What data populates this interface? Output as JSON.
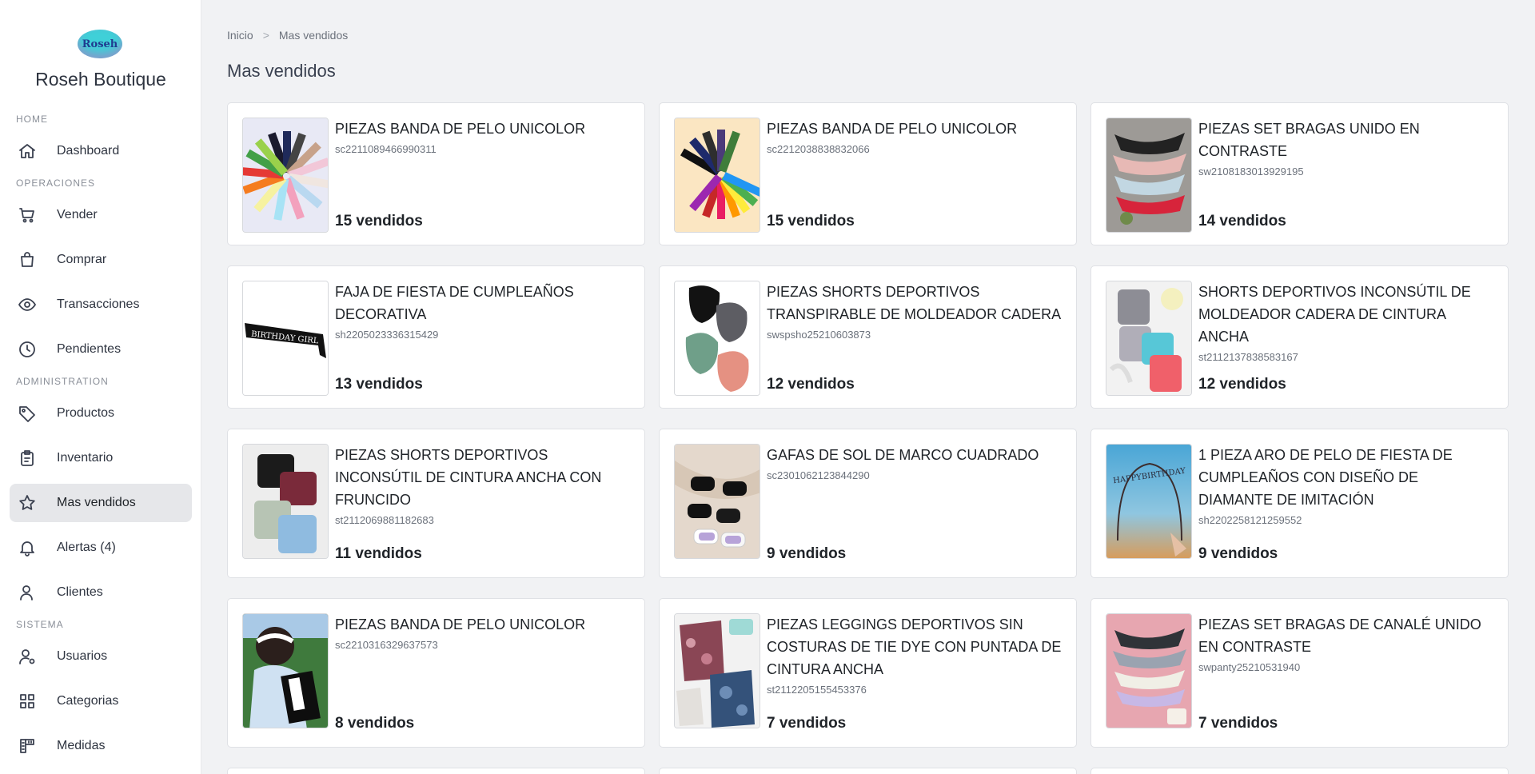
{
  "app": {
    "brand": "Roseh Boutique",
    "logo_text": "Roseh"
  },
  "sidebar": {
    "sections": [
      {
        "label": "HOME",
        "items": [
          {
            "label": "Dashboard",
            "icon": "home-icon"
          }
        ]
      },
      {
        "label": "OPERACIONES",
        "items": [
          {
            "label": "Vender",
            "icon": "cart-icon"
          },
          {
            "label": "Comprar",
            "icon": "shopping-bag-icon"
          },
          {
            "label": "Transacciones",
            "icon": "eye-icon"
          },
          {
            "label": "Pendientes",
            "icon": "clock-icon"
          }
        ]
      },
      {
        "label": "ADMINISTRATION",
        "items": [
          {
            "label": "Productos",
            "icon": "tag-icon"
          },
          {
            "label": "Inventario",
            "icon": "clipboard-icon"
          },
          {
            "label": "Mas vendidos",
            "icon": "star-icon",
            "active": true
          },
          {
            "label": "Alertas (4)",
            "icon": "bell-icon"
          },
          {
            "label": "Clientes",
            "icon": "user-icon"
          }
        ]
      },
      {
        "label": "SISTEMA",
        "items": [
          {
            "label": "Usuarios",
            "icon": "user-gear-icon"
          },
          {
            "label": "Categorias",
            "icon": "grid-icon"
          },
          {
            "label": "Medidas",
            "icon": "ruler-icon"
          }
        ]
      }
    ]
  },
  "breadcrumb": {
    "home": "Inicio",
    "current": "Mas vendidos"
  },
  "page": {
    "title": "Mas vendidos"
  },
  "products": [
    {
      "name": "PIEZAS BANDA DE PELO UNICOLOR",
      "sku": "sc2211089466990311",
      "sold": "15 vendidos",
      "thumb": "headbands-fan"
    },
    {
      "name": "PIEZAS BANDA DE PELO UNICOLOR",
      "sku": "sc2212038838832066",
      "sold": "15 vendidos",
      "thumb": "headbands-fan-cream"
    },
    {
      "name": "PIEZAS SET BRAGAS UNIDO EN CONTRASTE",
      "sku": "sw2108183013929195",
      "sold": "14 vendidos",
      "thumb": "panties"
    },
    {
      "name": "FAJA DE FIESTA DE CUMPLEAÑOS DECORATIVA",
      "sku": "sh2205023336315429",
      "sold": "13 vendidos",
      "thumb": "birthday-sash",
      "thumb_text": "BIRTHDAY GIRL"
    },
    {
      "name": "PIEZAS SHORTS DEPORTIVOS TRANSPIRABLE DE MOLDEADOR CADERA",
      "sku": "swspsho25210603873",
      "sold": "12 vendidos",
      "thumb": "shorts"
    },
    {
      "name": "SHORTS DEPORTIVOS INCONSÚTIL DE MOLDEADOR CADERA DE CINTURA ANCHA",
      "sku": "st2112137838583167",
      "sold": "12 vendidos",
      "thumb": "shorts-color"
    },
    {
      "name": "PIEZAS SHORTS DEPORTIVOS INCONSÚTIL DE CINTURA ANCHA CON FRUNCIDO",
      "sku": "st2112069881182683",
      "sold": "11 vendidos",
      "thumb": "shorts-stack"
    },
    {
      "name": "GAFAS DE SOL DE MARCO CUADRADO",
      "sku": "sc2301062123844290",
      "sold": "9 vendidos",
      "thumb": "sunglasses"
    },
    {
      "name": "1 PIEZA ARO DE PELO DE FIESTA DE CUMPLEAÑOS CON DISEÑO DE DIAMANTE DE IMITACIÓN",
      "sku": "sh2202258121259552",
      "sold": "9 vendidos",
      "thumb": "tiara",
      "thumb_text": "HAPPYBIRTHDAY"
    },
    {
      "name": "PIEZAS BANDA DE PELO UNICOLOR",
      "sku": "sc2210316329637573",
      "sold": "8 vendidos",
      "thumb": "headband-model"
    },
    {
      "name": "PIEZAS LEGGINGS DEPORTIVOS SIN COSTURAS DE TIE DYE CON PUNTADA DE CINTURA ANCHA",
      "sku": "st2112205155453376",
      "sold": "7 vendidos",
      "thumb": "leggings"
    },
    {
      "name": "PIEZAS SET BRAGAS DE CANALÉ UNIDO EN CONTRASTE",
      "sku": "swpanty25210531940",
      "sold": "7 vendidos",
      "thumb": "panties-pink"
    }
  ]
}
